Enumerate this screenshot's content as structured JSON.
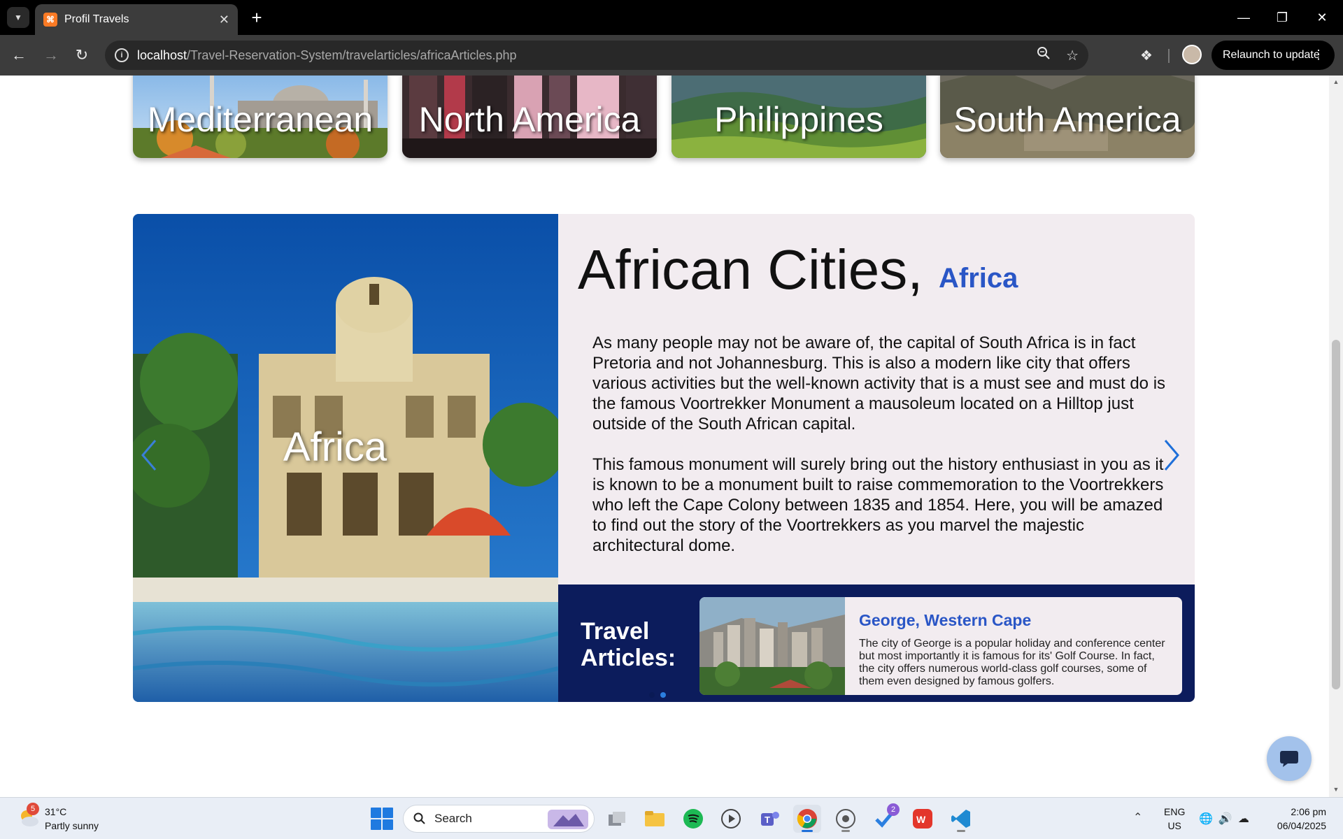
{
  "browser": {
    "tab_title": "Profil Travels",
    "url_host": "localhost",
    "url_path": "/Travel-Reservation-System/travelarticles/africaArticles.php",
    "relaunch_label": "Relaunch to update"
  },
  "regions": [
    {
      "label": "Mediterranean"
    },
    {
      "label": "North America"
    },
    {
      "label": "Philippines"
    },
    {
      "label": "South America"
    }
  ],
  "feature": {
    "image_label": "Africa",
    "title": "African Cities,",
    "subtitle": "Africa",
    "paragraphs": [
      "As many people may not be aware of, the capital of South Africa is in fact Pretoria and not Johannesburg. This is also a modern like city that offers various activities but the well-known activity that is a must see and must do is the famous Voortrekker Monument a mausoleum located on a Hilltop just outside of the South African capital.",
      "This famous monument will surely bring out the history enthusiast in you as it is known to be a monument built to raise commemoration to the Voortrekkers who left the Cape Colony between 1835 and 1854. Here, you will be amazed to find out the story of the Voortrekkers as you marvel the majestic architectural dome."
    ]
  },
  "travel_articles": {
    "label": "Travel Articles:",
    "card": {
      "title": "George, Western Cape",
      "text": "The city of George is a popular holiday and conference center but most importantly it is famous for its' Golf Course. In fact, the city offers numerous world-class golf courses, some of them even designed by famous golfers."
    },
    "active_dot_index": 1
  },
  "taskbar": {
    "weather_badge": "5",
    "weather_temp": "31°C",
    "weather_desc": "Partly sunny",
    "search_label": "Search",
    "todo_badge": "2",
    "lang_line1": "ENG",
    "lang_line2": "US",
    "time": "2:06 pm",
    "date": "06/04/2025"
  },
  "colors": {
    "accent_blue": "#2a56c6",
    "articles_bar": "#0c1c5c",
    "content_bg": "#f2ecf0"
  }
}
